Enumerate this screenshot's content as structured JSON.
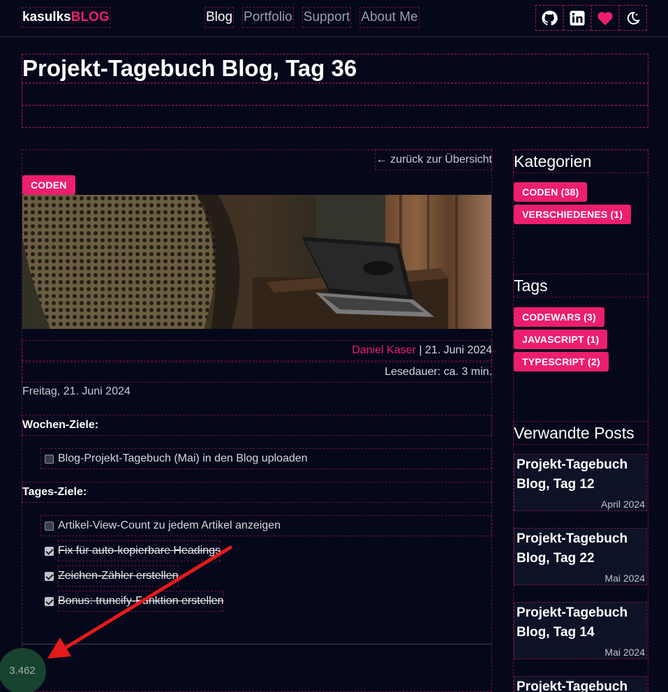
{
  "header": {
    "brand_name": "kasulks",
    "brand_suffix": "BLOG",
    "nav": [
      {
        "label": "Blog",
        "active": true
      },
      {
        "label": "Portfolio",
        "active": false
      },
      {
        "label": "Support",
        "active": false
      },
      {
        "label": "About Me",
        "active": false
      }
    ],
    "icons": [
      "github-icon",
      "linkedin-icon",
      "heart-icon",
      "theme-toggle-icon"
    ]
  },
  "post": {
    "title": "Projekt-Tagebuch Blog, Tag 36",
    "back_link": "← zurück zur Übersicht",
    "category": "CODEN",
    "author": "Daniel Kaser",
    "date": "21. Juni 2024",
    "reading_time": "Lesedauer: ca. 3 min.",
    "day_line": "Freitag, 21. Juni 2024",
    "week_heading": "Wochen-Ziele:",
    "week_tasks": [
      {
        "label": "Blog-Projekt-Tagebuch (Mai) in den Blog uploaden",
        "done": false
      }
    ],
    "day_heading": "Tages-Ziele:",
    "day_tasks": [
      {
        "label": "Artikel-View-Count zu jedem Artikel anzeigen",
        "done": false
      },
      {
        "label": "Fix für auto-kopierbare Headings",
        "done": true
      },
      {
        "label": "Zeichen-Zähler erstellen",
        "done": true
      },
      {
        "label": "Bonus: truncify-Funktion erstellen",
        "done": true
      }
    ]
  },
  "sidebar": {
    "categories_heading": "Kategorien",
    "categories": [
      "CODEN (38)",
      "VERSCHIEDENES (1)"
    ],
    "tags_heading": "Tags",
    "tags": [
      "CODEWARS (3)",
      "JAVASCRIPT (1)",
      "TYPESCRIPT (2)"
    ],
    "related_heading": "Verwandte Posts",
    "related": [
      {
        "title": "Projekt-Tagebuch Blog, Tag 12",
        "date": "April 2024"
      },
      {
        "title": "Projekt-Tagebuch Blog, Tag 22",
        "date": "Mai 2024"
      },
      {
        "title": "Projekt-Tagebuch Blog, Tag 14",
        "date": "Mai 2024"
      },
      {
        "title": "Projekt-Tagebuch",
        "date": ""
      }
    ]
  },
  "view_counter": "3.462",
  "colors": {
    "background": "#05081a",
    "accent": "#ec1e6e",
    "counter_bg": "#18432f",
    "annotation_arrow": "#e51a1a"
  }
}
